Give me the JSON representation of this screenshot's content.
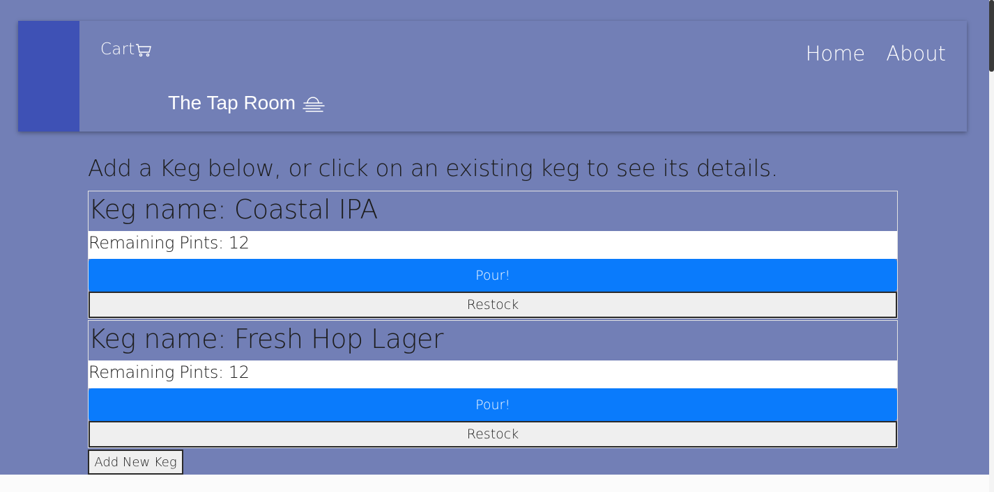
{
  "nav": {
    "cart_label": "Cart",
    "cart_icon": "shopping-cart-icon",
    "links": [
      {
        "label": "Home"
      },
      {
        "label": "About"
      }
    ],
    "brand_title": "The Tap Room",
    "brand_icon": "haze-icon",
    "accent_color": "#3e51b5"
  },
  "main": {
    "intro_text": "Add a Keg below, or click on an existing keg to see its details.",
    "kegs": [
      {
        "name_label": "Keg name: Coastal IPA",
        "pints_label": "Remaining Pints: 12",
        "pour_label": "Pour!",
        "restock_label": "Restock"
      },
      {
        "name_label": "Keg name: Fresh Hop Lager",
        "pints_label": "Remaining Pints: 12",
        "pour_label": "Pour!",
        "restock_label": "Restock"
      }
    ],
    "add_keg_label": "Add New Keg"
  },
  "colors": {
    "background": "#727fb6",
    "pour_button": "#0a7bfc"
  }
}
